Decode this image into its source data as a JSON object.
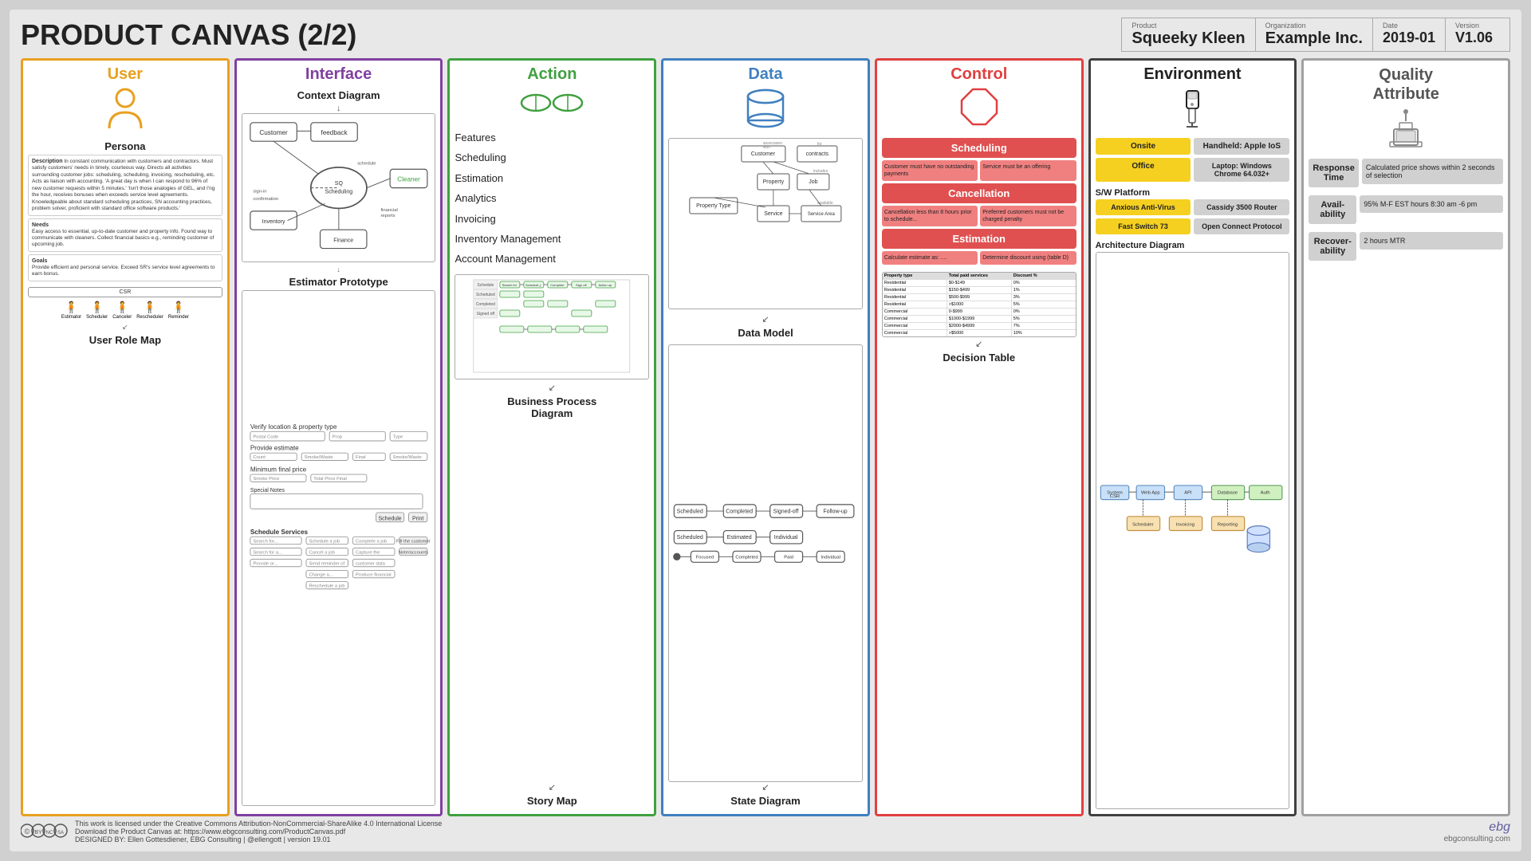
{
  "header": {
    "title": "PRODUCT CANVAS (2/2)",
    "product_label": "Product",
    "product_value": "Squeeky Kleen",
    "org_label": "Organization",
    "org_value": "Example Inc.",
    "date_label": "Date",
    "date_value": "2019-01",
    "version_label": "Version",
    "version_value": "V1.06"
  },
  "columns": {
    "user": {
      "header": "User",
      "persona_label": "Persona",
      "description_label": "Description",
      "description_text": "In constant communication with customers and contractors. Must satisfy customers' needs in timely, courteous way. Directs all activities surrounding customer jobs: scheduling, scheduling, invoicing, rescheduling, etc. Acts as liaison with accounting. 'A great day is when I can respond to 96% of new customer requests within 5 minutes.' 'Isn't those analogies of GEL, and I'ng the hour, receives bonuses when exceeds service level agreements. Knowledgeable about standard scheduling practices, SN accounting practices, problem solver, proficient with standard office software products.'",
      "needs_label": "Needs",
      "needs_text": "Easy access to essential, up-to-date customer and property info. Found way to communicate with cleaners. Collect financial basics e.g., reminding customer of upcoming job.",
      "goals_label": "Goals",
      "goals_text": "Provide efficient and personal service. Exceed SR's service level agreements to earn bonus.",
      "role_map_label": "User Role Map",
      "csr_label": "CSR",
      "roles": [
        "Estimator",
        "Scheduler",
        "Canceler",
        "Rescheduler",
        "Reminder"
      ]
    },
    "interface": {
      "header": "Interface",
      "context_diagram_label": "Context Diagram",
      "estimator_label": "Estimator Prototype",
      "arrow1": "↓",
      "arrow2": "↓"
    },
    "action": {
      "header": "Action",
      "items": [
        "Features",
        "Scheduling",
        "Estimation",
        "Analytics",
        "Invoicing",
        "Inventory Management",
        "Account Management"
      ],
      "bpd_label": "Business Process Diagram",
      "story_map_label": "Story Map"
    },
    "data": {
      "header": "Data",
      "data_model_label": "Data Model",
      "state_diagram_label": "State Diagram"
    },
    "control": {
      "header": "Control",
      "scheduling_label": "Scheduling",
      "scheduling_left": "Customer must have no outstanding payments",
      "scheduling_right": "Service must be an offering",
      "cancellation_label": "Cancellation",
      "cancellation_left": "Cancellation less than 8 hours prior to schedule...",
      "cancellation_right": "Preferred customers must not be charged penalty",
      "estimation_label": "Estimation",
      "estimation_left": "Calculate estimate as: ....",
      "estimation_right": "Determine discount using (table D)",
      "decision_table_label": "Decision Table",
      "dt_headers": [
        "Property type",
        "Total paid services",
        "Discount %"
      ],
      "dt_rows": [
        [
          "Residential",
          "$0-$149",
          "0%"
        ],
        [
          "Residential",
          "$150-$499",
          "1%"
        ],
        [
          "Residential",
          "$500-$999",
          "3%"
        ],
        [
          "Residential",
          ">$1000",
          "5%"
        ],
        [
          "Commercial",
          "0-$999",
          "0%"
        ],
        [
          "Commercial",
          "$1000-$1999",
          "5%"
        ],
        [
          "Commercial",
          "$2000-$4999",
          "7%"
        ],
        [
          "Commercial",
          ">$5000",
          "10%"
        ]
      ]
    },
    "environment": {
      "header": "Environment",
      "onsite_label": "Onsite",
      "handheld_label": "Handheld: Apple IoS",
      "office_label": "Office",
      "laptop_label": "Laptop: Windows Chrome 64.032+",
      "sw_platform_label": "S/W Platform",
      "antivirus_label": "Anxious Anti-Virus",
      "router_label": "Cassidy 3500 Router",
      "switch_label": "Fast Switch 73",
      "protocol_label": "Open Connect Protocol",
      "arch_label": "Architecture Diagram"
    },
    "quality": {
      "header": "Quality\nAttribute",
      "icon_label": "stamp-icon",
      "response_time_label": "Response Time",
      "response_time_value": "Calculated price shows within 2 seconds of selection",
      "availability_label": "Avail-ability",
      "availability_value": "95% M-F EST hours 8:30 am -6 pm",
      "recovery_label": "Recover-ability",
      "recovery_value": "2 hours MTR"
    }
  },
  "footer": {
    "license_text": "This work is licensed under the Creative Commons Attribution-NonCommercial-ShareAlike 4.0 International License",
    "download_text": "Download the Product Canvas at: https://www.ebgconsulting.com/ProductCanvas.pdf",
    "designer_text": "DESIGNED BY: Ellen Gottesdiener, EBG Consulting | @ellengott | version 19.01",
    "brand": "ebg",
    "website": "ebgconsulting.com"
  }
}
